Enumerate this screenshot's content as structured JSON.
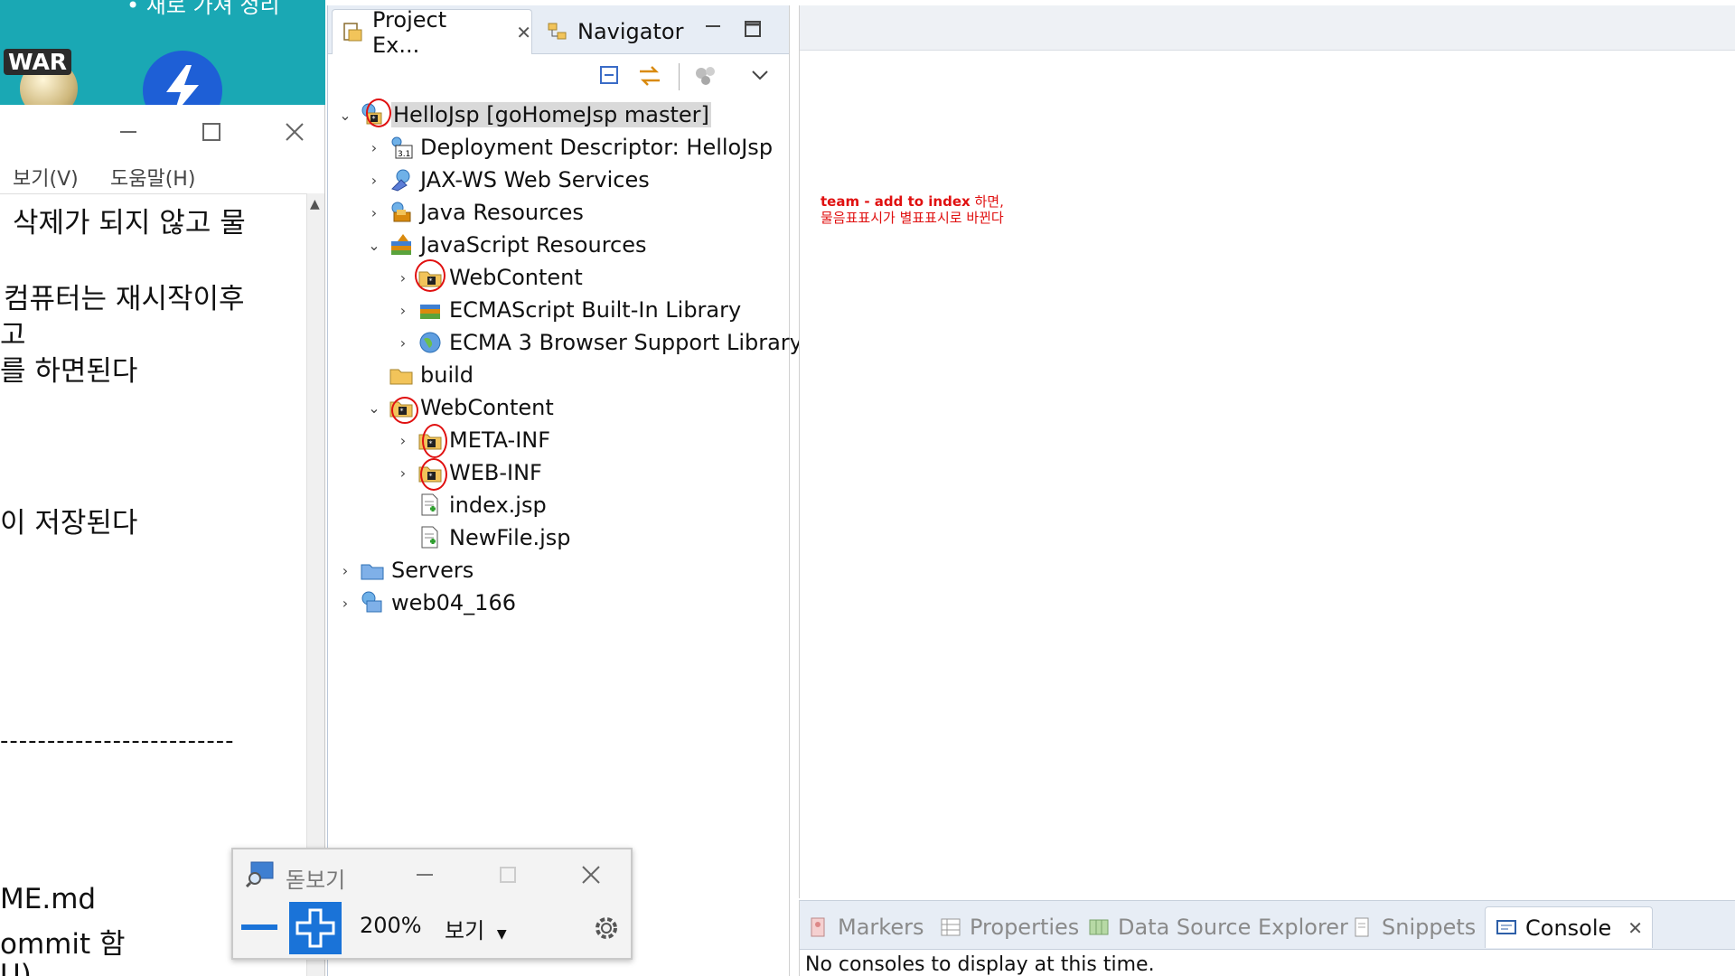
{
  "desktop": {
    "strip_text": "• 새로 가져     정리",
    "war_badge": "WAR"
  },
  "notepad": {
    "menu": [
      "보기(V)",
      "도움말(H)"
    ],
    "lines": [
      "삭제가 되지 않고 물",
      "컴퓨터는 재시작이후",
      "고",
      "를 하면된다",
      "이 저장된다",
      "-------------------------",
      "ME.md",
      "ommit 함",
      "U)"
    ]
  },
  "explorer": {
    "tabs": [
      {
        "label": "Project Ex...",
        "icon": "package-explorer-icon"
      },
      {
        "label": "Navigator",
        "icon": "navigator-icon"
      }
    ],
    "tree": [
      {
        "label": "HelloJsp [goHomeJsp master]",
        "icon": "web-project-icon",
        "expanded": true
      },
      {
        "label": "Deployment Descriptor: HelloJsp",
        "icon": "deployment-descriptor-icon",
        "expanded": false
      },
      {
        "label": "JAX-WS Web Services",
        "icon": "web-services-icon",
        "expanded": false
      },
      {
        "label": "Java Resources",
        "icon": "java-resources-icon",
        "expanded": false
      },
      {
        "label": "JavaScript Resources",
        "icon": "javascript-resources-icon",
        "expanded": true
      },
      {
        "label": "WebContent",
        "icon": "folder-icon",
        "expanded": false
      },
      {
        "label": "ECMAScript Built-In Library",
        "icon": "library-icon",
        "expanded": false
      },
      {
        "label": "ECMA 3 Browser Support Library",
        "icon": "globe-icon",
        "expanded": false
      },
      {
        "label": "build",
        "icon": "folder-icon"
      },
      {
        "label": "WebContent",
        "icon": "folder-icon",
        "expanded": true
      },
      {
        "label": "META-INF",
        "icon": "folder-icon",
        "expanded": false
      },
      {
        "label": "WEB-INF",
        "icon": "folder-icon",
        "expanded": false
      },
      {
        "label": "index.jsp",
        "icon": "jsp-file-icon"
      },
      {
        "label": "NewFile.jsp",
        "icon": "jsp-file-icon"
      },
      {
        "label": "Servers",
        "icon": "folder-icon",
        "expanded": false
      },
      {
        "label": "web04_166",
        "icon": "web-project-icon",
        "expanded": false
      }
    ]
  },
  "note": {
    "line1_bold": "team - add to index",
    "line1_rest": " 하면,",
    "line2": "물음표표시가 별표표시로 바뀐다"
  },
  "bottom_panel": {
    "tabs": [
      {
        "label": "Markers",
        "icon": "markers-icon"
      },
      {
        "label": "Properties",
        "icon": "properties-icon"
      },
      {
        "label": "Data Source Explorer",
        "icon": "data-source-icon"
      },
      {
        "label": "Snippets",
        "icon": "snippets-icon"
      },
      {
        "label": "Console",
        "icon": "console-icon"
      }
    ],
    "console_message": "No consoles to display at this time."
  },
  "magnifier": {
    "title": "돋보기",
    "zoom": "200%",
    "view_label": "보기"
  },
  "colors": {
    "annotation": "#e01010",
    "desktop": "#1aa8b4",
    "zoom_in_button": "#1a73d8"
  }
}
